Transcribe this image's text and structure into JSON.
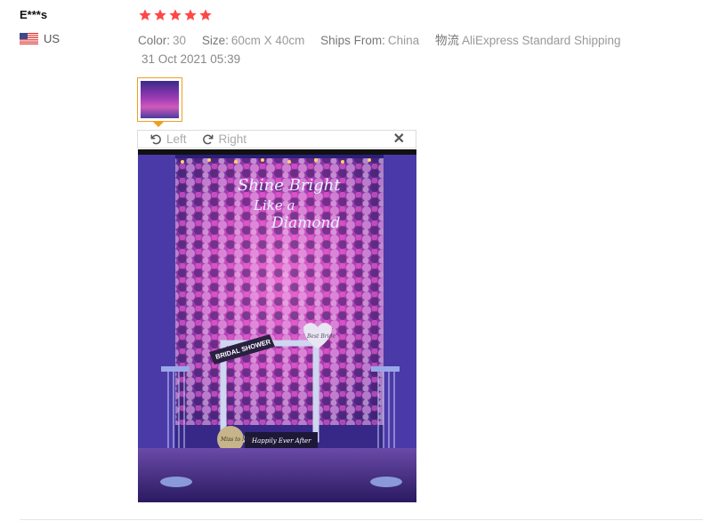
{
  "review": {
    "user_name": "E***s",
    "country": "US",
    "flag_icon": "us-flag-icon",
    "rating": 5,
    "star_color": "#ff4747",
    "color_label": "Color:",
    "color_value": "30",
    "size_label": "Size:",
    "size_value": "60cm X 40cm",
    "ships_from_label": "Ships From:",
    "ships_from_value": "China",
    "logistics_label": "物流",
    "logistics_value": "AliExpress Standard Shipping",
    "date": "31 Oct 2021 05:39"
  },
  "viewer": {
    "rotate_left_label": "Left",
    "rotate_right_label": "Right",
    "rotate_left_icon": "rotate-left-icon",
    "rotate_right_icon": "rotate-right-icon",
    "close_icon": "close-icon",
    "accent_color": "#f0a020",
    "photo_neon_text": [
      "Shine Bright",
      "Like a",
      "Diamond"
    ],
    "photo_sign_text": "BRIDAL SHOWER",
    "photo_banner_text": "Happily Ever After",
    "photo_round_sign_text": "Miss to Mrs",
    "photo_heart_text": "Best Bride"
  }
}
